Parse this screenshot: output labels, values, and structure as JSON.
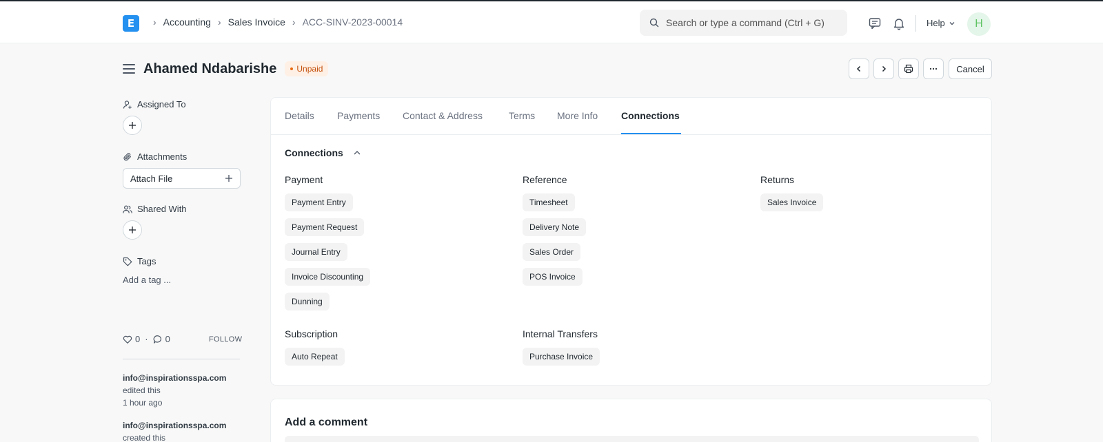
{
  "navbar": {
    "logo_letter": "E",
    "breadcrumbs": [
      "Accounting",
      "Sales Invoice",
      "ACC-SINV-2023-00014"
    ],
    "search_placeholder": "Search or type a command (Ctrl + G)",
    "help_label": "Help",
    "avatar_initial": "H"
  },
  "header": {
    "title": "Ahamed Ndabarishe",
    "status": "Unpaid",
    "cancel_label": "Cancel"
  },
  "sidebar": {
    "assigned_to": "Assigned To",
    "attachments": "Attachments",
    "attach_file": "Attach File",
    "shared_with": "Shared With",
    "tags": "Tags",
    "add_tag": "Add a tag ...",
    "likes": "0",
    "comments": "0",
    "follow": "FOLLOW",
    "activity": [
      {
        "user": "info@inspirationsspa.com",
        "action": "edited this",
        "time": "1 hour ago"
      },
      {
        "user": "info@inspirationsspa.com",
        "action": "created this"
      }
    ]
  },
  "tabs": [
    "Details",
    "Payments",
    "Contact & Address",
    "Terms",
    "More Info",
    "Connections"
  ],
  "active_tab": "Connections",
  "connections": {
    "section_title": "Connections",
    "groups": [
      {
        "title": "Payment",
        "items": [
          "Payment Entry",
          "Payment Request",
          "Journal Entry",
          "Invoice Discounting",
          "Dunning"
        ]
      },
      {
        "title": "Reference",
        "items": [
          "Timesheet",
          "Delivery Note",
          "Sales Order",
          "POS Invoice"
        ]
      },
      {
        "title": "Returns",
        "items": [
          "Sales Invoice"
        ]
      },
      {
        "title": "Subscription",
        "items": [
          "Auto Repeat"
        ]
      },
      {
        "title": "Internal Transfers",
        "items": [
          "Purchase Invoice"
        ]
      }
    ]
  },
  "comment": {
    "title": "Add a comment"
  },
  "colors": {
    "accent": "#2490ef",
    "status_bg": "#fff0e6",
    "status_text": "#c4520d"
  }
}
